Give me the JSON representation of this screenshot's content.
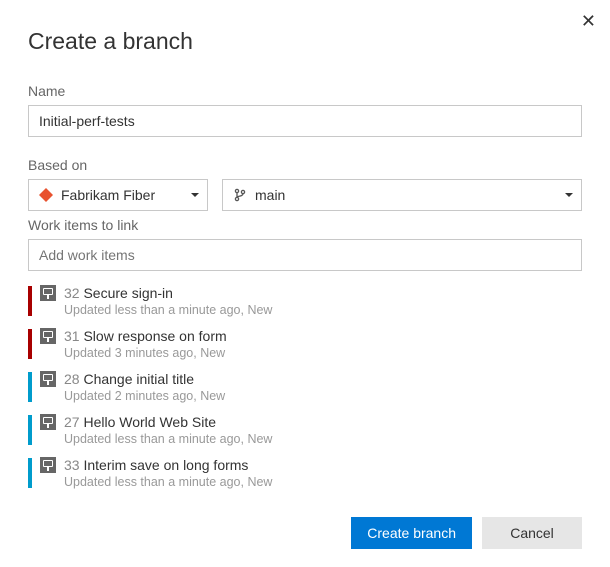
{
  "dialog": {
    "title": "Create a branch",
    "name_label": "Name",
    "name_value": "Initial-perf-tests",
    "based_on_label": "Based on",
    "repo_name": "Fabrikam Fiber",
    "branch_name": "main",
    "work_items_label": "Work items to link",
    "work_items_placeholder": "Add work items",
    "primary_button": "Create branch",
    "cancel_button": "Cancel"
  },
  "work_items": [
    {
      "id": "32",
      "title": "Secure sign-in",
      "subtitle": "Updated less than a minute ago, New",
      "accent": "#a80000"
    },
    {
      "id": "31",
      "title": "Slow response on form",
      "subtitle": "Updated 3 minutes ago, New",
      "accent": "#a80000"
    },
    {
      "id": "28",
      "title": "Change initial title",
      "subtitle": "Updated 2 minutes ago, New",
      "accent": "#009ccc"
    },
    {
      "id": "27",
      "title": "Hello World Web Site",
      "subtitle": "Updated less than a minute ago, New",
      "accent": "#009ccc"
    },
    {
      "id": "33",
      "title": "Interim save on long forms",
      "subtitle": "Updated less than a minute ago, New",
      "accent": "#009ccc"
    }
  ]
}
